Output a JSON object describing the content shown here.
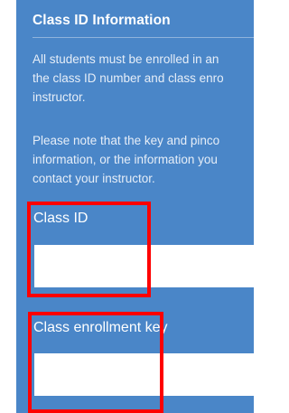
{
  "section": {
    "title": "Class ID Information"
  },
  "paragraphs": [
    {
      "lines": [
        "All students must be enrolled in an",
        "the class ID number and class enro",
        "instructor."
      ]
    },
    {
      "lines": [
        "Please note that the key and pinco",
        "information, or the information you",
        "contact your instructor."
      ]
    }
  ],
  "fields": {
    "class_id": {
      "label": "Class ID",
      "value": ""
    },
    "enrollment_key": {
      "label": "Class enrollment key",
      "value": ""
    }
  },
  "colors": {
    "panel": "#4a86c8",
    "highlight": "#ff0000"
  }
}
